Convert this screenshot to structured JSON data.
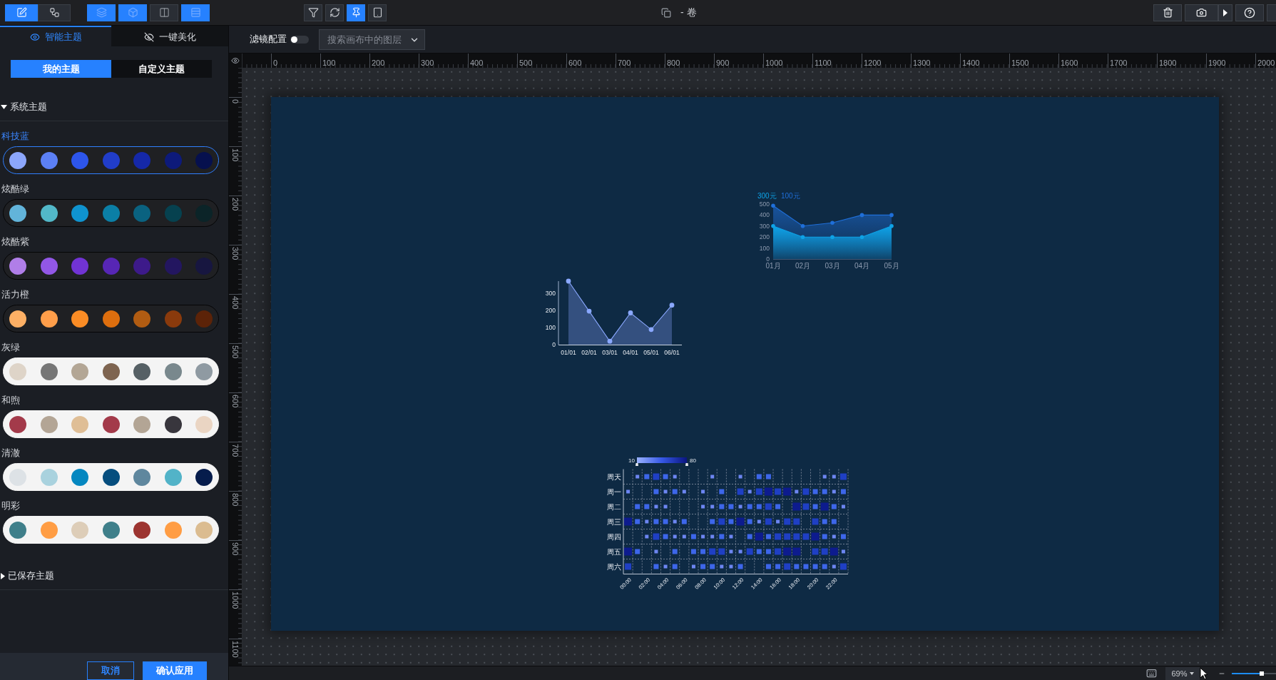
{
  "toolbar": {
    "mode_buttons": [
      {
        "on": true
      },
      {
        "on": false
      }
    ],
    "panel_buttons": [
      {
        "on": true
      },
      {
        "on": true
      },
      {
        "on": false
      },
      {
        "on": true
      }
    ],
    "view_buttons": [
      {
        "on": false
      },
      {
        "on": false
      },
      {
        "on": true
      },
      {
        "on": false
      }
    ],
    "title": "- 卷"
  },
  "side_panel": {
    "tabs": [
      {
        "label": "智能主题",
        "selected": true
      },
      {
        "label": "一键美化",
        "selected": false
      }
    ],
    "theme_tabs": [
      {
        "label": "我的主题",
        "selected": true
      },
      {
        "label": "自定义主题",
        "selected": false
      }
    ],
    "system_themes": {
      "title": "系统主题",
      "expanded": true,
      "themes": [
        {
          "name": "科技蓝",
          "selected": true,
          "kind": "dark",
          "swatches": [
            {
              "color": "#8ca6fb"
            },
            {
              "color": "#5c80f5"
            },
            {
              "color": "#2d55eb"
            },
            {
              "color": "#213dc9"
            },
            {
              "color": "#1528a8"
            },
            {
              "color": "#0d1a7a"
            },
            {
              "color": "#06104e"
            }
          ]
        },
        {
          "name": "炫酷绿",
          "selected": false,
          "kind": "dark",
          "swatches": [
            {
              "color": "#62b4da"
            },
            {
              "color": "#52b8c8"
            },
            {
              "color": "#0f93cf"
            },
            {
              "color": "#0b7fa6"
            },
            {
              "color": "#0a6280"
            },
            {
              "color": "#06414f"
            },
            {
              "color": "#0b2428"
            }
          ]
        },
        {
          "name": "炫酷紫",
          "selected": false,
          "kind": "dark",
          "swatches": [
            {
              "color": "#b07ee8"
            },
            {
              "color": "#9257e6"
            },
            {
              "color": "#7133d4"
            },
            {
              "color": "#5726b5"
            },
            {
              "color": "#3d1a8a"
            },
            {
              "color": "#231660"
            },
            {
              "color": "#171640"
            }
          ]
        },
        {
          "name": "活力橙",
          "selected": false,
          "kind": "dark",
          "swatches": [
            {
              "color": "#fdb065"
            },
            {
              "color": "#ff9e4a"
            },
            {
              "color": "#fa8c25"
            },
            {
              "color": "#dd6e0e"
            },
            {
              "color": "#b15c12"
            },
            {
              "color": "#8a3a0c"
            },
            {
              "color": "#5c2308"
            }
          ]
        },
        {
          "name": "灰绿",
          "selected": false,
          "kind": "light",
          "swatches": [
            {
              "color": "#ded4c8"
            },
            {
              "color": "#767676"
            },
            {
              "color": "#b3a695"
            },
            {
              "color": "#7e6450"
            },
            {
              "color": "#566065"
            },
            {
              "color": "#79888d"
            },
            {
              "color": "#8f9aa2"
            }
          ]
        },
        {
          "name": "和煦",
          "selected": false,
          "kind": "light",
          "swatches": [
            {
              "color": "#a33a4a"
            },
            {
              "color": "#b3a595"
            },
            {
              "color": "#dfbe96"
            },
            {
              "color": "#a33a4a"
            },
            {
              "color": "#b3a595"
            },
            {
              "color": "#38363d"
            },
            {
              "color": "#ead5c3"
            }
          ]
        },
        {
          "name": "清澈",
          "selected": false,
          "kind": "light",
          "swatches": [
            {
              "color": "#dde2e6"
            },
            {
              "color": "#a9d2de"
            },
            {
              "color": "#0587c0"
            },
            {
              "color": "#064e7e"
            },
            {
              "color": "#5f879e"
            },
            {
              "color": "#52b3c8"
            },
            {
              "color": "#061c4c"
            }
          ]
        },
        {
          "name": "明彩",
          "selected": false,
          "kind": "light",
          "swatches": [
            {
              "color": "#3f7f8a"
            },
            {
              "color": "#ff9d44"
            },
            {
              "color": "#ddcdb8"
            },
            {
              "color": "#3f7f8a"
            },
            {
              "color": "#9c3430"
            },
            {
              "color": "#ff9d44"
            },
            {
              "color": "#dbbc90"
            }
          ]
        }
      ]
    },
    "saved_themes": {
      "title": "已保存主题",
      "expanded": false
    },
    "buttons": [
      {
        "label": "取消",
        "kind": "secondary"
      },
      {
        "label": "确认应用",
        "kind": "primary"
      }
    ]
  },
  "canvas_bar": {
    "filter": {
      "label": "滤镜配置",
      "on": false
    },
    "layer_search": {
      "placeholder": "搜索画布中的图层"
    }
  },
  "rulers": {
    "x_labels": [
      "0",
      "100",
      "200",
      "300",
      "400",
      "500",
      "600",
      "700",
      "800",
      "900",
      "1000",
      "1100",
      "1200",
      "1300",
      "1400",
      "1500",
      "1600",
      "1700",
      "1800",
      "1900",
      "2000"
    ],
    "y_labels": [
      "0",
      "100",
      "200",
      "300",
      "400",
      "500",
      "600",
      "700",
      "800",
      "900",
      "1000",
      "1100"
    ]
  },
  "artboard": {
    "area_chart": {
      "chart_data": {
        "type": "area",
        "categories": [
          "01月",
          "02月",
          "03月",
          "04月",
          "05月"
        ],
        "series": [
          {
            "name": "300元",
            "color": "#0ea2e6",
            "values": [
              300,
              200,
              200,
              200,
              300
            ]
          },
          {
            "name": "100元",
            "color": "#1f6fd9",
            "values": [
              485,
              300,
              330,
              400,
              400
            ]
          }
        ],
        "ylim": [
          0,
          500
        ],
        "yticks": [
          0,
          100,
          200,
          300,
          400,
          500
        ]
      }
    },
    "line_chart": {
      "chart_data": {
        "type": "area",
        "categories": [
          "01/01",
          "02/01",
          "03/01",
          "04/01",
          "05/01",
          "06/01"
        ],
        "values": [
          370,
          195,
          20,
          185,
          88,
          230
        ],
        "ylim": [
          0,
          370
        ],
        "yticks": [
          0,
          100,
          200,
          300
        ]
      }
    },
    "heatmap": {
      "scale_min": "10",
      "scale_max": "80",
      "days": [
        "周天",
        "周一",
        "周二",
        "周三",
        "周四",
        "周五",
        "周六"
      ],
      "hours": [
        "00:00",
        "02:00",
        "04:00",
        "06:00",
        "08:00",
        "10:00",
        "12:00",
        "14:00",
        "16:00",
        "18:00",
        "20:00",
        "22:00"
      ]
    }
  },
  "status_bar": {
    "zoom": "69%",
    "zoom_slider": {
      "level": 0.69
    }
  }
}
